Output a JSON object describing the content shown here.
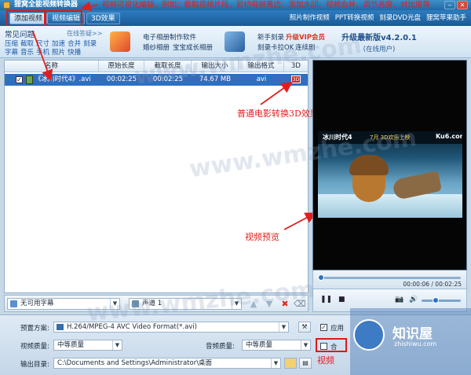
{
  "app": {
    "title": "狸窝全能视频转换器"
  },
  "annotations": {
    "top": "视频可视化编辑，例如：截取视频片段、剪切视频黑边、添加水印、视频合并、调节亮度、对比度等",
    "convert3d": "普通电影转换3D效果",
    "preview": "视频预览",
    "bottom": "视频"
  },
  "tabs": [
    {
      "label": "添加视频"
    },
    {
      "label": "视频编辑"
    },
    {
      "label": "3D效果"
    }
  ],
  "toplinks": [
    "照片制作视频",
    "PPT转换视频",
    "刻录DVD光盘",
    "狸窝苹果助手"
  ],
  "quick": {
    "title": "常见问题",
    "more": "在线答疑>>",
    "row1": [
      "压缩",
      "截取",
      "尺寸",
      "加速",
      "合并",
      "刻录"
    ],
    "row2": [
      "字幕",
      "音乐",
      "手机",
      "照片",
      "快播"
    ]
  },
  "promo": {
    "p1_line1": "电子相册制作软件",
    "p1_line2a": "婚纱相册",
    "p1_line2b": "宝宝成长相册",
    "p2_line1a": "新手刻录",
    "p2_line1b": "升级VIP会员",
    "p2_line2a": "刻录卡拉OK",
    "p2_line2b": "连续剧"
  },
  "upgrade": {
    "main": "升级最新版v4.2.0.1",
    "sub": "(在线用户)"
  },
  "table": {
    "headers": [
      "名称",
      "原始长度",
      "截取长度",
      "输出大小",
      "输出格式",
      "3D"
    ],
    "rows": [
      {
        "name": "《冰川时代4》.avi",
        "orig": "00:02:25",
        "clip": "00:02:25",
        "size": "74.67 MB",
        "format": "avi",
        "badge": "3D"
      }
    ]
  },
  "listbar": {
    "subtitle": "无可用字幕",
    "audio": "声道 1"
  },
  "preview": {
    "movie_title": "冰川时代4",
    "movie_date": "7月 3D欢乐上映",
    "movie_logo": "Ku6.com",
    "time": "00:00:06 / 00:02:25"
  },
  "settings": {
    "preset_label": "预置方案:",
    "preset_value": "H.264/MPEG-4 AVC Video Format(*.avi)",
    "vq_label": "视频质量:",
    "vq_value": "中等质量",
    "aq_label": "音频质量:",
    "aq_value": "中等质量",
    "out_label": "输出目录:",
    "out_value": "C:\\Documents and Settings\\Administrator\\桌面",
    "apply_label": "应用",
    "merge_label": "合"
  },
  "brand": {
    "name": "知识屋",
    "url": "zhishiwu.com"
  },
  "watermark": "www.wmzhe.com",
  "colors": {
    "accent": "#2f6fbf",
    "annotation": "#e21d1d",
    "titlebar": "#1f69a6"
  }
}
